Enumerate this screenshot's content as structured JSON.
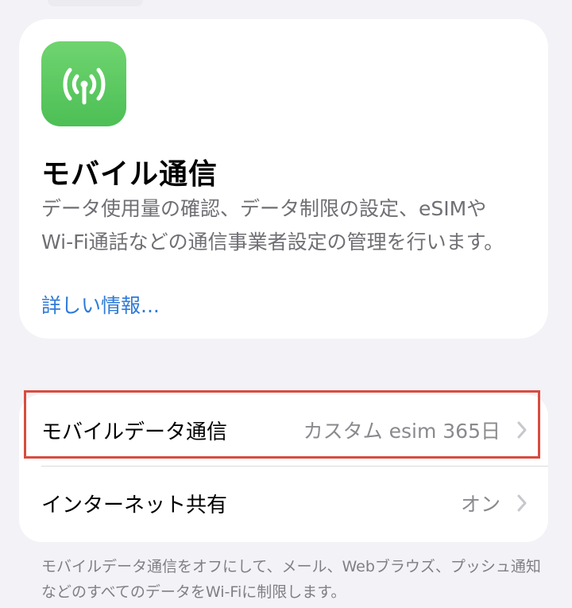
{
  "hero": {
    "icon": "antenna-signal-icon",
    "icon_color": "#4cbf55",
    "title": "モバイル通信",
    "description": "データ使用量の確認、データ制限の設定、eSIMやWi-Fi通話などの通信事業者設定の管理を行います。",
    "link": "詳しい情報..."
  },
  "settings": {
    "mobile_data": {
      "label": "モバイルデータ通信",
      "value": "カスタム esim 365日"
    },
    "hotspot": {
      "label": "インターネット共有",
      "value": "オン"
    }
  },
  "footer": {
    "note": "モバイルデータ通信をオフにして、メール、Webブラウズ、プッシュ通知などのすべてのデータをWi-Fiに制限します。"
  },
  "colors": {
    "accent_link": "#2f7ad9",
    "highlight_border": "#d94c3d",
    "background": "#f2f2f7"
  }
}
